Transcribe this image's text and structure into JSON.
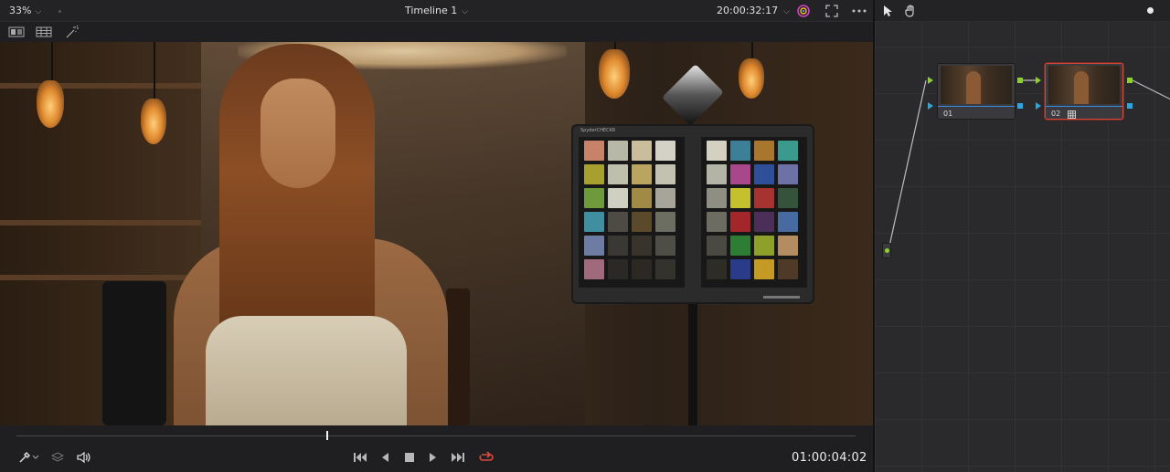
{
  "viewer": {
    "zoom": "33%",
    "timeline_title": "Timeline 1",
    "source_timecode": "20:00:32:17",
    "record_timecode": "01:00:04:02",
    "playhead_fraction": 0.37
  },
  "nodes": [
    {
      "label": "01",
      "selected": false
    },
    {
      "label": "02",
      "selected": true
    }
  ],
  "checker": {
    "brand": "SpyderCHECKR",
    "left_patches": [
      "#c8826a",
      "#b7b8a6",
      "#c9bd9c",
      "#d4d1c6",
      "#a8a02e",
      "#bfbfae",
      "#b9a560",
      "#c3c1b0",
      "#6f9a3b",
      "#cfcfc2",
      "#a08a45",
      "#a7a59a",
      "#3f8fa0",
      "#4e4b44",
      "#5a4a2b",
      "#6d6e62",
      "#6e7ba2",
      "#3a3834",
      "#38342c",
      "#4e4e46",
      "#a16a7c",
      "#2a2925",
      "#2c2822",
      "#33322c"
    ],
    "right_patches": [
      "#d4d0c2",
      "#3d7f97",
      "#a8762c",
      "#3b9a8e",
      "#b4b4a6",
      "#a8478a",
      "#2f4f9a",
      "#6d72a6",
      "#8e8e82",
      "#c5c12e",
      "#a6332f",
      "#35533a",
      "#6d6c62",
      "#a3262b",
      "#4b2f58",
      "#476aa0",
      "#4b4a42",
      "#2d7d35",
      "#8ea02a",
      "#b38c62",
      "#2d2c27",
      "#2a3b8a",
      "#c59a24",
      "#4f3a28"
    ]
  },
  "colors": {
    "accent_red": "#d2493a",
    "port_green": "#8fd12a",
    "port_blue": "#2aa6e0"
  }
}
